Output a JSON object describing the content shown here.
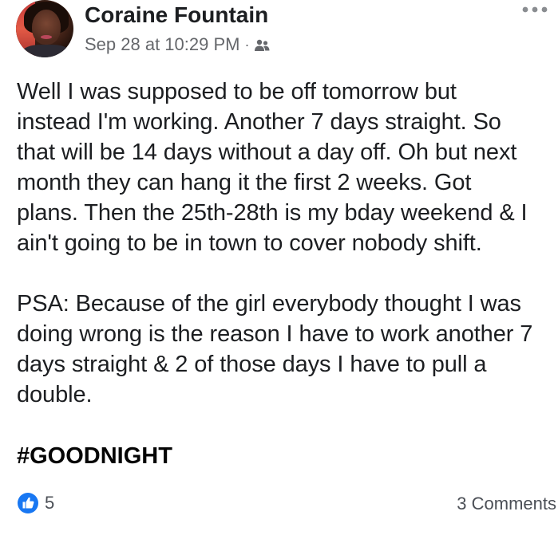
{
  "post": {
    "author": "Coraine Fountain",
    "timestamp": "Sep 28 at 10:29 PM",
    "separator": "·",
    "audience_icon": "friends-icon",
    "more_icon": "more-options-icon",
    "paragraph1": "Well I was supposed to be off tomorrow but\ninstead I'm working. Another 7 days straight. So\nthat will be 14 days without a day off. Oh but next\nmonth they can hang it the first 2 weeks. Got\nplans. Then the 25th-28th is my bday weekend & I\nain't going to be in town to cover nobody shift.",
    "paragraph2": "PSA: Because of the girl everybody thought I was\ndoing wrong is the reason I have to work another 7\ndays straight & 2 of those days I have to pull a\ndouble.",
    "hashtag": "#GOODNIGHT"
  },
  "footer": {
    "reaction_icon": "like-icon",
    "reaction_count": "5",
    "comments": "3 Comments"
  },
  "colors": {
    "text": "#1c1e21",
    "secondary": "#65676b",
    "like_blue": "#1877f2"
  }
}
